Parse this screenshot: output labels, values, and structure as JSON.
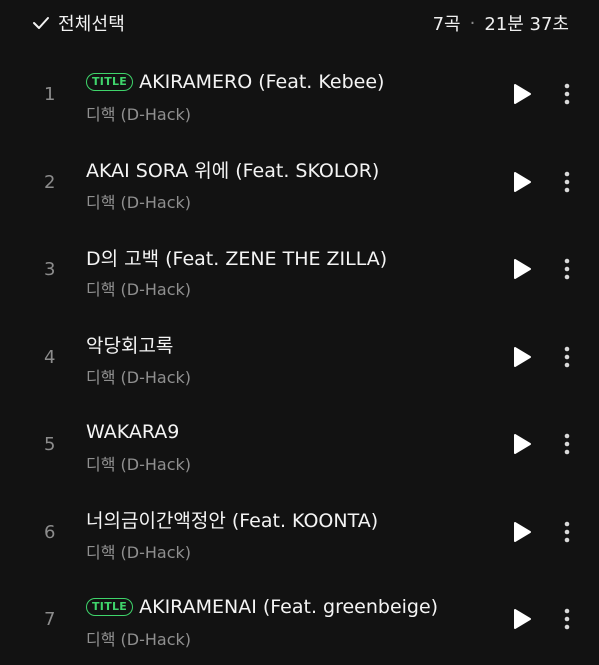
{
  "header": {
    "select_all_label": "전체선택",
    "track_count": "7곡",
    "separator": "·",
    "total_duration": "21분 37초"
  },
  "title_badge_label": "TITLE",
  "accent_color": "#3fd46b",
  "icons": {
    "select_all": "checkmark-icon",
    "play": "play-icon",
    "more": "more-vertical-icon"
  },
  "tracks": [
    {
      "number": "1",
      "title": "AKIRAMERO (Feat. Kebee)",
      "artist": "디핵 (D-Hack)",
      "is_title": true
    },
    {
      "number": "2",
      "title": "AKAI SORA 위에 (Feat. SKOLOR)",
      "artist": "디핵 (D-Hack)",
      "is_title": false
    },
    {
      "number": "3",
      "title": "D의 고백 (Feat. ZENE THE ZILLA)",
      "artist": "디핵 (D-Hack)",
      "is_title": false
    },
    {
      "number": "4",
      "title": "악당회고록",
      "artist": "디핵 (D-Hack)",
      "is_title": false
    },
    {
      "number": "5",
      "title": "WAKARA9",
      "artist": "디핵 (D-Hack)",
      "is_title": false
    },
    {
      "number": "6",
      "title": "너의금이간액정안 (Feat. KOONTA)",
      "artist": "디핵 (D-Hack)",
      "is_title": false
    },
    {
      "number": "7",
      "title": "AKIRAMENAI (Feat. greenbeige)",
      "artist": "디핵 (D-Hack)",
      "is_title": true
    }
  ]
}
